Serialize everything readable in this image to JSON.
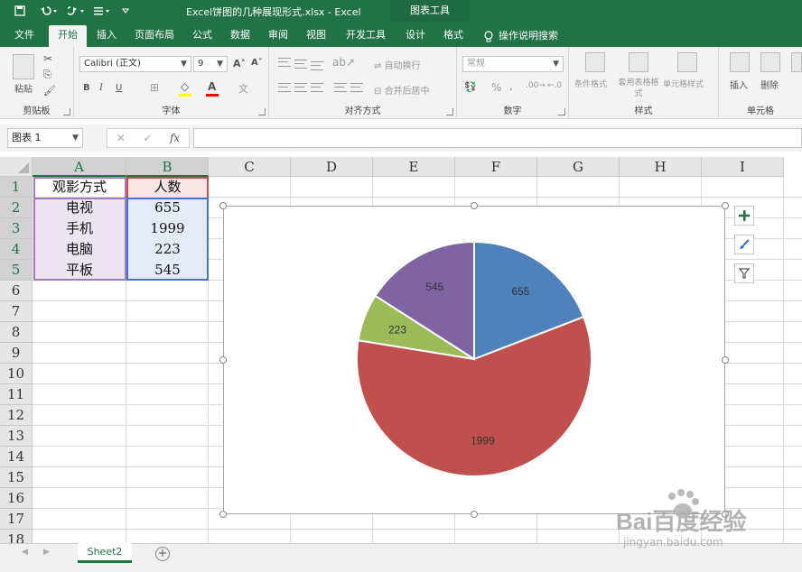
{
  "window": {
    "title": "Excel饼图的几种展现形式.xlsx  -  Excel",
    "context_tab": "图表工具"
  },
  "ribbon_tabs": [
    {
      "label": "文件"
    },
    {
      "label": "开始"
    },
    {
      "label": "插入"
    },
    {
      "label": "页面布局"
    },
    {
      "label": "公式"
    },
    {
      "label": "数据"
    },
    {
      "label": "审阅"
    },
    {
      "label": "视图"
    },
    {
      "label": "开发工具"
    },
    {
      "label": "设计"
    },
    {
      "label": "格式"
    }
  ],
  "tell_me": "操作说明搜索",
  "ribbon": {
    "clipboard": {
      "label": "剪贴板",
      "paste": "粘贴"
    },
    "font": {
      "label": "字体",
      "name": "Calibri (正文)",
      "size": "9",
      "bold": "B",
      "italic": "I",
      "underline": "U"
    },
    "alignment": {
      "label": "对齐方式",
      "wrap": "自动换行",
      "merge": "合并后居中"
    },
    "number": {
      "label": "数字",
      "format": "常规",
      "percent": "%",
      "comma": ","
    },
    "styles": {
      "label": "样式",
      "conditional": "条件格式",
      "table": "套用表格格式",
      "cell_styles": "单元格样式"
    },
    "cells": {
      "label": "单元格",
      "insert": "插入",
      "delete": "删除"
    }
  },
  "formula_bar": {
    "name_box": "图表 1",
    "fx": "fx",
    "value": ""
  },
  "columns": [
    "A",
    "B",
    "C",
    "D",
    "E",
    "F",
    "G",
    "H",
    "I"
  ],
  "rows": [
    "1",
    "2",
    "3",
    "4",
    "5",
    "6",
    "7",
    "8",
    "9",
    "10",
    "11",
    "12",
    "13",
    "14",
    "15",
    "16",
    "17",
    "18"
  ],
  "table": {
    "headers": [
      "观影方式",
      "人数"
    ],
    "rows": [
      [
        "电视",
        "655"
      ],
      [
        "手机",
        "1999"
      ],
      [
        "电脑",
        "223"
      ],
      [
        "平板",
        "545"
      ]
    ]
  },
  "chart_data": {
    "type": "pie",
    "categories": [
      "电视",
      "手机",
      "电脑",
      "平板"
    ],
    "values": [
      655,
      1999,
      223,
      545
    ],
    "colors": [
      "#4f81bd",
      "#c0504d",
      "#9bbb59",
      "#8064a2"
    ],
    "data_labels": [
      "655",
      "1999",
      "223",
      "545"
    ],
    "start_angle_deg": 0,
    "legend": "none"
  },
  "sheets": [
    {
      "label": "Sheet2",
      "active": true
    }
  ],
  "watermark": {
    "text": "Bai百度经验",
    "url": "jingyan.baidu.com"
  },
  "colors": {
    "excel_green": "#217346",
    "ribbon_bg": "#f3f3f3"
  }
}
